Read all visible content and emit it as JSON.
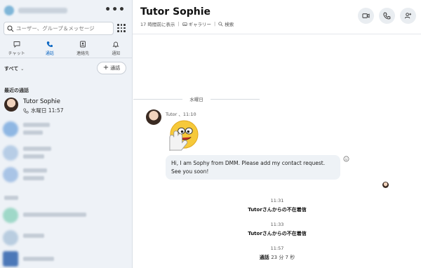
{
  "sidebar": {
    "search_placeholder": "ユーザー、グループ＆メッセージ",
    "nav": [
      {
        "label": "チャット",
        "icon": "chat-icon"
      },
      {
        "label": "通話",
        "icon": "phone-icon",
        "active": true
      },
      {
        "label": "連絡先",
        "icon": "contacts-icon"
      },
      {
        "label": "通知",
        "icon": "bell-icon"
      }
    ],
    "filter_label": "すべて",
    "new_call_label": "通話",
    "section_label": "最近の通話",
    "recent": [
      {
        "name": "Tutor Sophie",
        "detail": "水曜日 11:57",
        "selected": true
      }
    ]
  },
  "header": {
    "title": "Tutor Sophie",
    "last_seen": "17 時間前に表示",
    "gallery": "ギャラリー",
    "search": "検索"
  },
  "chat": {
    "day_divider": "水曜日",
    "message": {
      "sender_meta": "Tutor 、11:10",
      "text": "Hi, I am Sophy from DMM. Please add my contact request. See you soon!"
    },
    "calls": [
      {
        "time": "11:31",
        "text": "Tutorさんからの不在着信"
      },
      {
        "time": "11:33",
        "text": "Tutorさんからの不在着信"
      },
      {
        "time": "11:57",
        "text": "通話",
        "duration": "23 分 7 秒"
      }
    ]
  },
  "colors": {
    "accent": "#0a66c2",
    "sidebar_bg": "#eef2f7",
    "bubble_bg": "#eef2f6"
  }
}
